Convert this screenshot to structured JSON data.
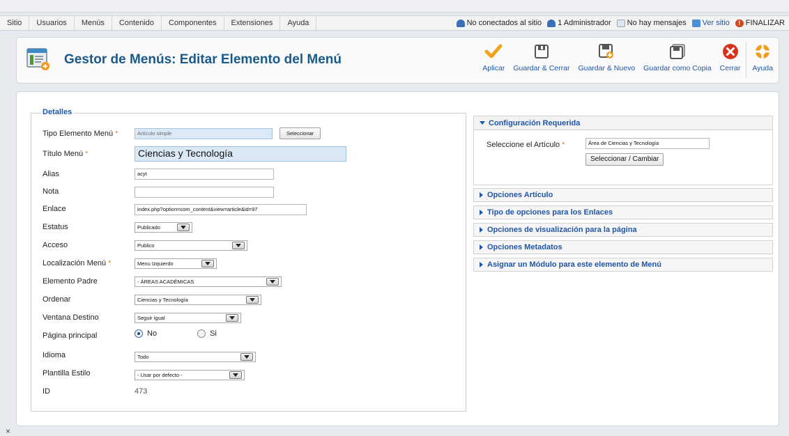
{
  "menubar": {
    "items": [
      "Sitio",
      "Usuarios",
      "Menús",
      "Contenido",
      "Componentes",
      "Extensiones",
      "Ayuda"
    ],
    "status": {
      "not_connected": "No conectados al sitio",
      "admins": "1 Administrador",
      "messages": "No hay mensajes",
      "view_site": "Ver sitio",
      "logout": "FINALIZAR"
    }
  },
  "header": {
    "title": "Gestor de Menús: Editar Elemento del Menú"
  },
  "toolbar": {
    "apply": "Aplicar",
    "save_close": "Guardar & Cerrar",
    "save_new": "Guardar & Nuevo",
    "save_copy": "Guardar como Copia",
    "close": "Cerrar",
    "help": "Ayuda"
  },
  "details": {
    "legend": "Detalles",
    "menu_type": {
      "label": "Tipo Elemento Menú",
      "value": "Artículo simple",
      "button": "Seleccionar"
    },
    "title": {
      "label": "Título Menú",
      "value": "Ciencias y Tecnología"
    },
    "alias": {
      "label": "Alias",
      "value": "acyt"
    },
    "note": {
      "label": "Nota",
      "value": ""
    },
    "link": {
      "label": "Enlace",
      "value": "index.php?option=com_content&view=article&id=97"
    },
    "status": {
      "label": "Estatus",
      "value": "Publicado"
    },
    "access": {
      "label": "Acceso",
      "value": "Publico"
    },
    "menu_location": {
      "label": "Localización Menú",
      "value": "Menu Izquierdo"
    },
    "parent": {
      "label": "Elemento Padre",
      "value": "- ÁREAS ACADÉMICAS"
    },
    "order": {
      "label": "Ordenar",
      "value": "Ciencias y Tecnología"
    },
    "target": {
      "label": "Ventana Destino",
      "value": "Seguir igual"
    },
    "home": {
      "label": "Página principal",
      "no": "No",
      "yes": "Si"
    },
    "language": {
      "label": "Idioma",
      "value": "Todo"
    },
    "template": {
      "label": "Plantilla Estilo",
      "value": "- Usar por defecto -"
    },
    "id": {
      "label": "ID",
      "value": "473"
    }
  },
  "right": {
    "required": {
      "title": "Configuración Requerida",
      "article_label": "Seleccione el Artículo",
      "article_value": "Área de Ciencias y Tecnología",
      "button": "Seleccionar / Cambiar"
    },
    "sections": [
      "Opciones Artículo",
      "Tipo de opciones para los Enlaces",
      "Opciones de visualización para la página",
      "Opciones Metadatos",
      "Asignar un Módulo para este elemento de Menú"
    ]
  },
  "colors": {
    "title_blue": "#1a5a8a",
    "link_blue": "#1f55a8",
    "required_star": "#d28b25",
    "apply_check": "#f0a21b",
    "close_red": "#d9321c"
  }
}
